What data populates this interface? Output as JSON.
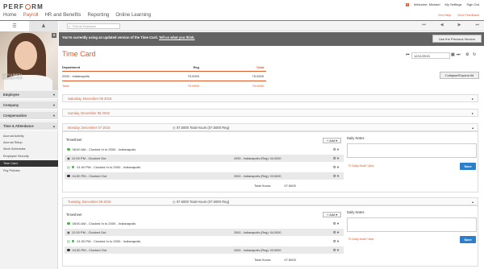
{
  "app": {
    "logo": "PERFORM"
  },
  "nav": [
    "Home",
    "Payroll",
    "HR and Benefits",
    "Reporting",
    "Online Learning"
  ],
  "nav_active": 1,
  "top_links": {
    "welcome": "Welcome, Michael",
    "settings": "My Settings",
    "signout": "Sign Out",
    "help": "Get Help",
    "feedback": "Give Feedback"
  },
  "sidebar": {
    "employee_label": "DARLA SMITH",
    "employee_sub": "Employee #101",
    "sections": [
      "Employee",
      "Company",
      "Compensation",
      "Time & Attendance"
    ],
    "items": [
      "Accrual Activity",
      "Accrual Setup",
      "Work Schedules",
      "Employee Security",
      "Time Card",
      "Pay Policies"
    ],
    "selected_item": "Time Card"
  },
  "toolbar": {
    "search_placeholder": "Find an Employee"
  },
  "banner": {
    "text": "You're currently using an updated version of the Time Card.",
    "link": "Tell us what you think.",
    "button": "Use the Previous Version"
  },
  "timecard": {
    "title": "Time Card",
    "date": "12/11/2015",
    "collapse_button": "Collapse/Expand All",
    "summary": {
      "headers": [
        "Department",
        "Reg",
        "Total"
      ],
      "rows": [
        {
          "dept": "2000 - Indianapolis",
          "reg": "75.0000",
          "total": "75.0000"
        }
      ],
      "total": {
        "label": "Total",
        "reg": "75.0000",
        "total": "75.0000"
      }
    },
    "collapsed_days": [
      "Saturday, December 05 2015",
      "Sunday, December 06 2015"
    ],
    "days": [
      {
        "date": "Monday, December 07 2015",
        "total": "07.5000 Total Hours (07.5000 Reg)",
        "timesheet_label": "Timesheet",
        "add_label": "Add",
        "entries": [
          {
            "time": "08:00 AM - Clocked In to 2000 - Indianapolis",
            "hours": ""
          },
          {
            "time": "12:00 PM - Clocked Out",
            "hours": "2000 - Indianapolis (Reg): 04.0000"
          },
          {
            "time": "01:00 PM - Clocked In to 2000 - Indianapolis",
            "hours": ""
          },
          {
            "time": "04:30 PM - Clocked Out",
            "hours": "2000 - Indianapolis (Reg): 03.5000"
          }
        ],
        "total_label": "Total Hours:",
        "total_value": "07.5000",
        "notes_label": "Daily Notes",
        "audit_label": "Daily Audit View",
        "save_label": "Save"
      },
      {
        "date": "Tuesday, December 08 2015",
        "total": "07.5000 Total Hours (07.5000 Reg)",
        "timesheet_label": "Timesheet",
        "add_label": "Add",
        "entries": [
          {
            "time": "08:00 AM - Clocked In to 2000 - Indianapolis",
            "hours": ""
          },
          {
            "time": "12:00 PM - Clocked Out",
            "hours": "2000 - Indianapolis (Reg): 04.0000"
          },
          {
            "time": "01:00 PM - Clocked In to 2000 - Indianapolis",
            "hours": ""
          },
          {
            "time": "04:30 PM - Clocked Out",
            "hours": "2000 - Indianapolis (Reg): 03.5000"
          }
        ],
        "total_label": "Total Hours:",
        "total_value": "07.5000",
        "notes_label": "Daily Notes",
        "audit_label": "Daily Audit View",
        "save_label": "Save"
      }
    ]
  },
  "colors": {
    "accent": "#e05a2a",
    "banner": "#636363",
    "save": "#2e7fc9"
  }
}
